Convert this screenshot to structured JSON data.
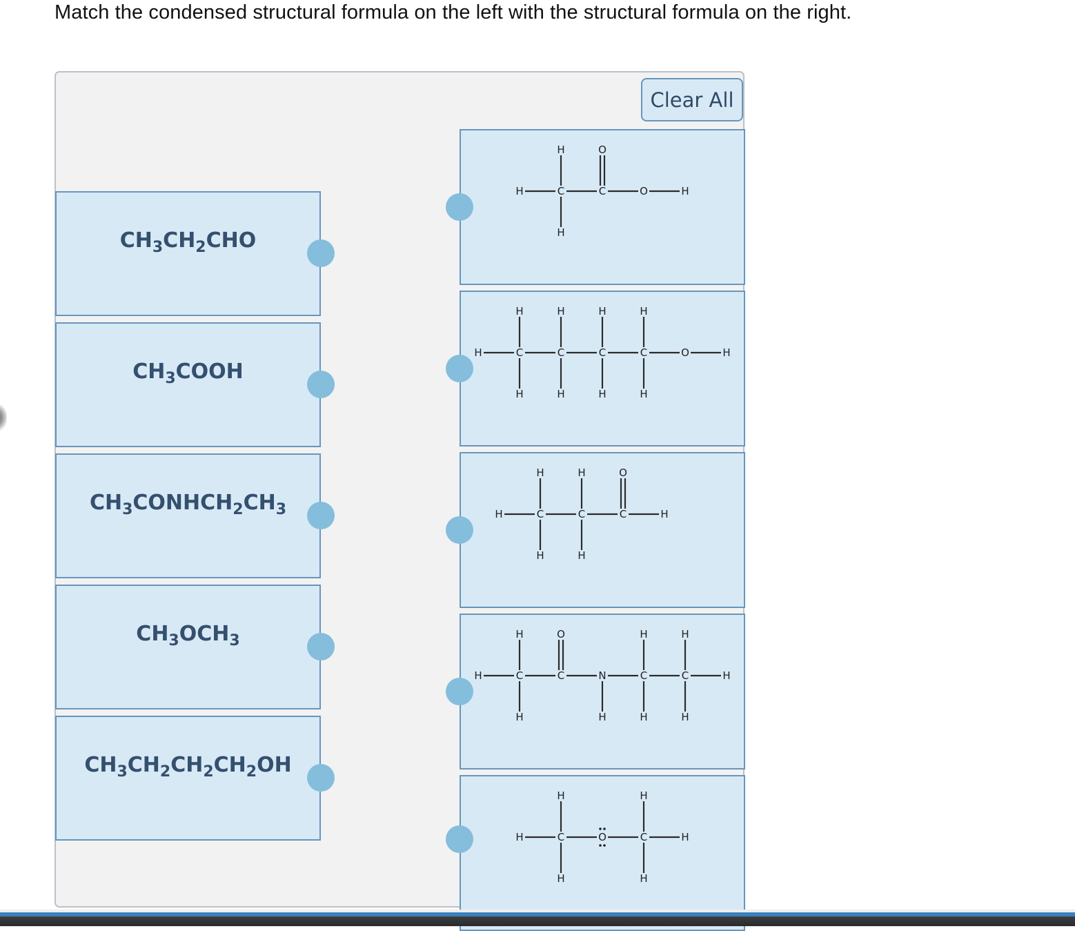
{
  "instructions": "Match the condensed structural formula on the left with the structural formula on the right.",
  "clear_all_label": "Clear All",
  "left_items": [
    {
      "parts": [
        [
          "CH",
          ""
        ],
        [
          "3",
          "sub"
        ],
        [
          "CH",
          ""
        ],
        [
          "2",
          "sub"
        ],
        [
          "CHO",
          ""
        ]
      ],
      "text": "CH3CH2CHO"
    },
    {
      "parts": [
        [
          "CH",
          ""
        ],
        [
          "3",
          "sub"
        ],
        [
          "COOH",
          ""
        ]
      ],
      "text": "CH3COOH"
    },
    {
      "parts": [
        [
          "CH",
          ""
        ],
        [
          "3",
          "sub"
        ],
        [
          "CONHCH",
          ""
        ],
        [
          "2",
          "sub"
        ],
        [
          "CH",
          ""
        ],
        [
          "3",
          "sub"
        ]
      ],
      "text": "CH3CONHCH2CH3"
    },
    {
      "parts": [
        [
          "CH",
          ""
        ],
        [
          "3",
          "sub"
        ],
        [
          "OCH",
          ""
        ],
        [
          "3",
          "sub"
        ]
      ],
      "text": "CH3OCH3"
    },
    {
      "parts": [
        [
          "CH",
          ""
        ],
        [
          "3",
          "sub"
        ],
        [
          "CH",
          ""
        ],
        [
          "2",
          "sub"
        ],
        [
          "CH",
          ""
        ],
        [
          "2",
          "sub"
        ],
        [
          "CH",
          ""
        ],
        [
          "2",
          "sub"
        ],
        [
          "OH",
          ""
        ]
      ],
      "text": "CH3CH2CH2CH2OH"
    }
  ],
  "right_items": [
    {
      "name": "acetic-acid-structure",
      "atoms": [
        [
          "H",
          0,
          1
        ],
        [
          "C",
          1,
          1
        ],
        [
          "H",
          1,
          0
        ],
        [
          "H",
          1,
          2
        ],
        [
          "C",
          2,
          1
        ],
        [
          "O",
          2,
          0
        ],
        [
          "O",
          3,
          1
        ],
        [
          "H",
          4,
          1
        ]
      ],
      "bonds": [
        [
          0,
          1,
          1
        ],
        [
          1,
          2,
          1
        ],
        [
          1,
          3,
          1
        ],
        [
          1,
          4,
          1
        ],
        [
          4,
          5,
          2
        ],
        [
          4,
          6,
          1
        ],
        [
          6,
          7,
          1
        ]
      ],
      "lone_pairs": []
    },
    {
      "name": "butanol-structure",
      "atoms": [
        [
          "H",
          0,
          1
        ],
        [
          "C",
          1,
          1
        ],
        [
          "H",
          1,
          0
        ],
        [
          "H",
          1,
          2
        ],
        [
          "C",
          2,
          1
        ],
        [
          "H",
          2,
          0
        ],
        [
          "H",
          2,
          2
        ],
        [
          "C",
          3,
          1
        ],
        [
          "H",
          3,
          0
        ],
        [
          "H",
          3,
          2
        ],
        [
          "C",
          4,
          1
        ],
        [
          "H",
          4,
          0
        ],
        [
          "H",
          4,
          2
        ],
        [
          "O",
          5,
          1
        ],
        [
          "H",
          6,
          1
        ]
      ],
      "bonds": [
        [
          0,
          1,
          1
        ],
        [
          1,
          2,
          1
        ],
        [
          1,
          3,
          1
        ],
        [
          1,
          4,
          1
        ],
        [
          4,
          5,
          1
        ],
        [
          4,
          6,
          1
        ],
        [
          4,
          7,
          1
        ],
        [
          7,
          8,
          1
        ],
        [
          7,
          9,
          1
        ],
        [
          7,
          10,
          1
        ],
        [
          10,
          11,
          1
        ],
        [
          10,
          12,
          1
        ],
        [
          10,
          13,
          1
        ],
        [
          13,
          14,
          1
        ]
      ],
      "lone_pairs": []
    },
    {
      "name": "propanal-structure",
      "atoms": [
        [
          "H",
          0,
          1
        ],
        [
          "C",
          1,
          1
        ],
        [
          "H",
          1,
          0
        ],
        [
          "H",
          1,
          2
        ],
        [
          "C",
          2,
          1
        ],
        [
          "H",
          2,
          0
        ],
        [
          "H",
          2,
          2
        ],
        [
          "C",
          3,
          1
        ],
        [
          "O",
          3,
          0
        ],
        [
          "H",
          4,
          1
        ]
      ],
      "bonds": [
        [
          0,
          1,
          1
        ],
        [
          1,
          2,
          1
        ],
        [
          1,
          3,
          1
        ],
        [
          1,
          4,
          1
        ],
        [
          4,
          5,
          1
        ],
        [
          4,
          6,
          1
        ],
        [
          4,
          7,
          1
        ],
        [
          7,
          8,
          2
        ],
        [
          7,
          9,
          1
        ]
      ],
      "lone_pairs": []
    },
    {
      "name": "n-ethylacetamide-structure",
      "atoms": [
        [
          "H",
          0,
          1
        ],
        [
          "C",
          1,
          1
        ],
        [
          "H",
          1,
          0
        ],
        [
          "H",
          1,
          2
        ],
        [
          "C",
          2,
          1
        ],
        [
          "O",
          2,
          0
        ],
        [
          "N",
          3,
          1
        ],
        [
          "H",
          3,
          2
        ],
        [
          "C",
          4,
          1
        ],
        [
          "H",
          4,
          0
        ],
        [
          "H",
          4,
          2
        ],
        [
          "C",
          5,
          1
        ],
        [
          "H",
          5,
          0
        ],
        [
          "H",
          5,
          2
        ],
        [
          "H",
          6,
          1
        ]
      ],
      "bonds": [
        [
          0,
          1,
          1
        ],
        [
          1,
          2,
          1
        ],
        [
          1,
          3,
          1
        ],
        [
          1,
          4,
          1
        ],
        [
          4,
          5,
          2
        ],
        [
          4,
          6,
          1
        ],
        [
          6,
          7,
          1
        ],
        [
          6,
          8,
          1
        ],
        [
          8,
          9,
          1
        ],
        [
          8,
          10,
          1
        ],
        [
          8,
          11,
          1
        ],
        [
          11,
          12,
          1
        ],
        [
          11,
          13,
          1
        ],
        [
          11,
          14,
          1
        ]
      ],
      "lone_pairs": []
    },
    {
      "name": "dimethyl-ether-structure",
      "atoms": [
        [
          "H",
          0,
          1
        ],
        [
          "C",
          1,
          1
        ],
        [
          "H",
          1,
          0
        ],
        [
          "H",
          1,
          2
        ],
        [
          "O",
          2,
          1
        ],
        [
          "C",
          3,
          1
        ],
        [
          "H",
          3,
          0
        ],
        [
          "H",
          3,
          2
        ],
        [
          "H",
          4,
          1
        ]
      ],
      "bonds": [
        [
          0,
          1,
          1
        ],
        [
          1,
          2,
          1
        ],
        [
          1,
          3,
          1
        ],
        [
          1,
          4,
          1
        ],
        [
          4,
          5,
          1
        ],
        [
          5,
          6,
          1
        ],
        [
          5,
          7,
          1
        ],
        [
          5,
          8,
          1
        ]
      ],
      "lone_pairs": [
        4
      ]
    }
  ]
}
